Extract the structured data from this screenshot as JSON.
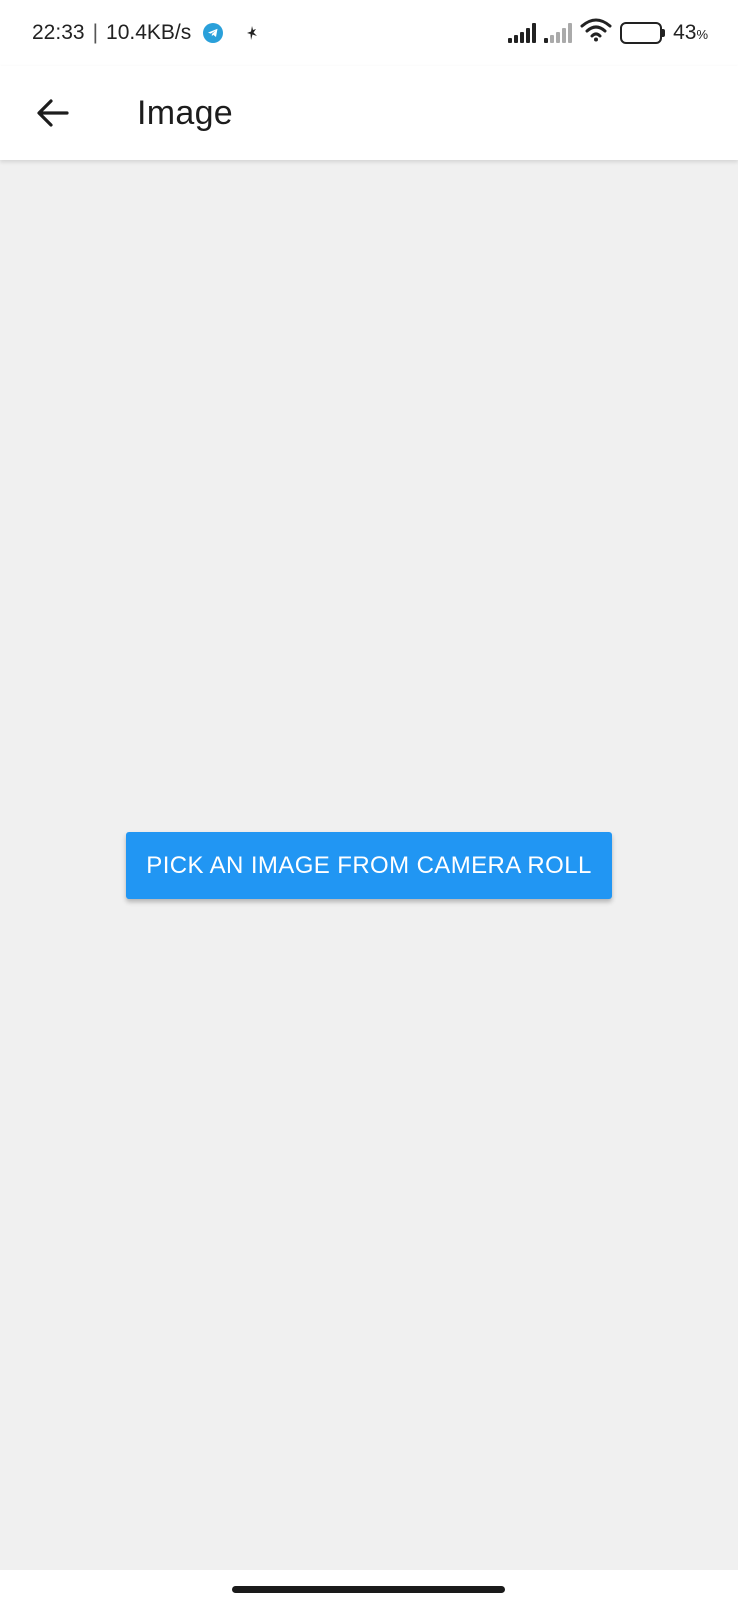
{
  "status_bar": {
    "time": "22:33",
    "separator": "|",
    "network_speed": "10.4KB/s",
    "battery_percent": "43",
    "battery_percent_unit": "%",
    "battery_level": 0.43,
    "icons": [
      "telegram-icon",
      "satellite-icon",
      "signal-strength-icon",
      "signal-strength-icon",
      "wifi-icon",
      "battery-icon"
    ]
  },
  "app_bar": {
    "back_icon": "arrow-left-icon",
    "title": "Image"
  },
  "main": {
    "pick_button_label": "PICK AN IMAGE FROM CAMERA ROLL"
  },
  "colors": {
    "accent": "#2196f3",
    "background": "#f0f0f0",
    "app_bar": "#ffffff"
  }
}
